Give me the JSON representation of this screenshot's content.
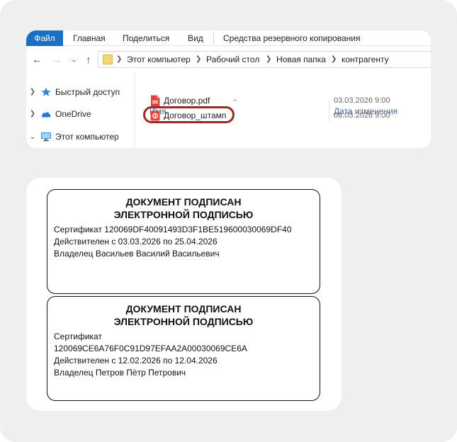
{
  "ribbon": {
    "tabs": [
      "Файл",
      "Главная",
      "Поделиться",
      "Вид",
      "Средства резервного копирования"
    ]
  },
  "address": {
    "crumbs": [
      "Этот компьютер",
      "Рабочий стол",
      "Новая папка",
      "контрагенту"
    ]
  },
  "nav_pane": {
    "items": [
      {
        "label": "Быстрый доступ",
        "icon": "star-icon",
        "chevron": "chevron-right-icon"
      },
      {
        "label": "OneDrive",
        "icon": "cloud-icon",
        "chevron": "chevron-right-icon"
      },
      {
        "label": "Этот компьютер",
        "icon": "computer-icon",
        "chevron": "chevron-down-icon"
      }
    ]
  },
  "file_list": {
    "columns": {
      "name": "Имя",
      "date": "Дата изменения"
    },
    "files": [
      {
        "name": "Договор.pdf",
        "date": "03.03.2026 9:00",
        "icon": "pdf-file-icon"
      },
      {
        "name": "Договор_штамп",
        "date": "03.03.2026 9:00",
        "icon": "pdf-file-icon",
        "highlighted": true
      }
    ]
  },
  "stamps": [
    {
      "heading_line1": "ДОКУМЕНТ ПОДПИСАН",
      "heading_line2": "ЭЛЕКТРОННОЙ ПОДПИСЬЮ",
      "lines": [
        "Сертификат 120069DF40091493D3F1BE519600030069DF40",
        "Действителен с 03.03.2026 по 25.04.2026",
        "Владелец Васильев Василий Васильевич"
      ]
    },
    {
      "heading_line1": "ДОКУМЕНТ ПОДПИСАН",
      "heading_line2": "ЭЛЕКТРОННОЙ ПОДПИСЬЮ",
      "lines": [
        "Сертификат",
        "120069CE6A76F0C91D97EFAA2A00030069CE6A",
        "Действителен с 12.02.2026 по 12.04.2026",
        "Владелец Петров Пётр Петрович"
      ]
    }
  ],
  "colors": {
    "file_tab": "#1a6fc2",
    "highlight_ring": "#9b2a26",
    "background": "#efefef"
  }
}
